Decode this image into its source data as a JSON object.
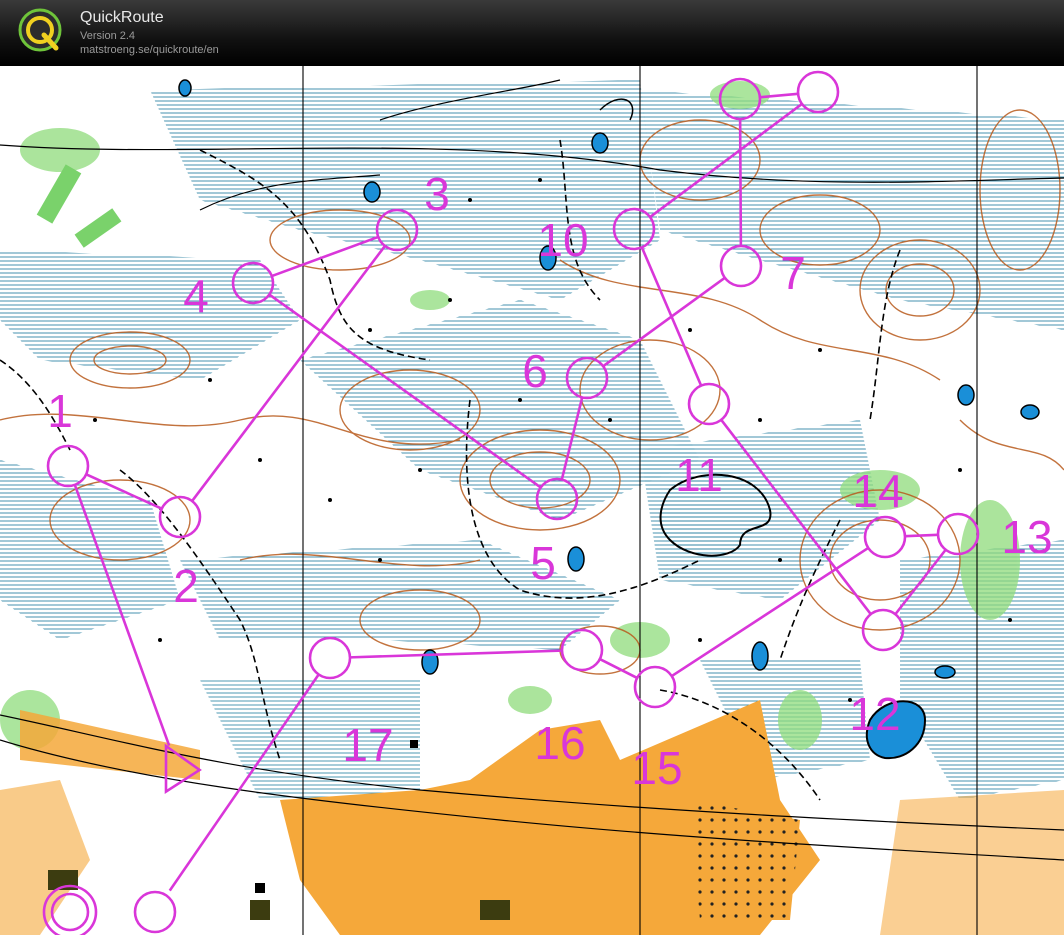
{
  "app": {
    "name": "QuickRoute",
    "version": "Version 2.4",
    "url": "matstroeng.se/quickroute/en"
  },
  "colors": {
    "course": "#d936d9",
    "open_land": "#f5a83a",
    "forest": "#ffffff",
    "green": "#7fd66f",
    "marsh": "#1a7d9a",
    "water": "#1a8fd8",
    "contour": "#b85a1c",
    "rock": "#000000"
  },
  "course": {
    "controls": [
      {
        "id": "start",
        "label": ""
      },
      {
        "id": "1",
        "label": "1"
      },
      {
        "id": "2",
        "label": "2"
      },
      {
        "id": "3",
        "label": "3"
      },
      {
        "id": "4",
        "label": "4"
      },
      {
        "id": "5",
        "label": "5"
      },
      {
        "id": "6",
        "label": "6"
      },
      {
        "id": "7",
        "label": "7"
      },
      {
        "id": "8",
        "label": ""
      },
      {
        "id": "9",
        "label": ""
      },
      {
        "id": "10",
        "label": "10"
      },
      {
        "id": "11",
        "label": "11"
      },
      {
        "id": "12",
        "label": "12"
      },
      {
        "id": "13",
        "label": "13"
      },
      {
        "id": "14",
        "label": "14"
      },
      {
        "id": "15",
        "label": "15"
      },
      {
        "id": "16",
        "label": "16"
      },
      {
        "id": "17",
        "label": "17"
      },
      {
        "id": "finish",
        "label": ""
      }
    ]
  }
}
